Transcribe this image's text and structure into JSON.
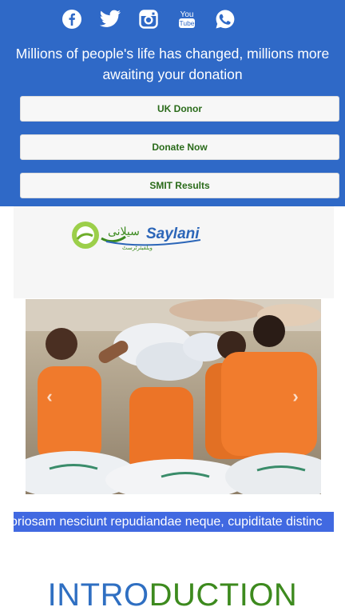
{
  "social": {
    "icons": [
      "facebook-icon",
      "twitter-icon",
      "instagram-icon",
      "youtube-icon",
      "whatsapp-icon"
    ],
    "youtube_text": "You\nTube"
  },
  "hero": {
    "text": "Millions of people's life has changed, millions more awaiting your donation"
  },
  "buttons": {
    "uk_donor": "UK Donor",
    "donate_now": "Donate Now",
    "smit_results": "SMIT Results"
  },
  "brand": {
    "logo_text": "Saylani",
    "urdu_text": "سیلانی"
  },
  "carousel": {
    "prev": "‹",
    "next": "›"
  },
  "ticker": {
    "text": "oriosam nesciunt repudiandae neque, cupiditate distinc"
  },
  "intro": {
    "part1": "INTRO",
    "part2": "DUCTION"
  },
  "colors": {
    "header_bg": "#2f69c7",
    "button_text": "#2a6b1a",
    "ticker_bg": "#4169e1",
    "intro_blue": "#2f6fc2",
    "intro_green": "#3d8a1e"
  }
}
